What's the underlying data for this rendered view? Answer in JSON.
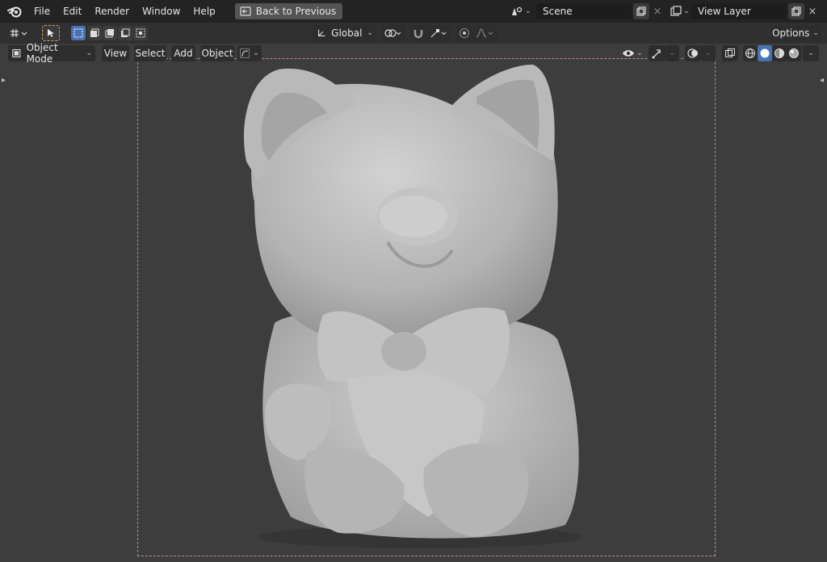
{
  "topbar": {
    "menu": [
      "File",
      "Edit",
      "Render",
      "Window",
      "Help"
    ],
    "back_button": "Back to Previous",
    "scene_value": "Scene",
    "view_layer_value": "View Layer"
  },
  "header": {
    "transform_orientation": "Global",
    "options_label": "Options"
  },
  "viewport_header": {
    "mode": "Object Mode",
    "menus": [
      "View",
      "Select",
      "Add",
      "Object"
    ]
  },
  "icons": {
    "logo": "blender-logo-icon",
    "editor_type": "viewport-editor-icon",
    "select_tool": "cursor-select-icon",
    "pivot": "pivot-icon",
    "snap": "magnet-snap-icon",
    "proportional": "proportional-edit-icon",
    "visibility": "eye-icon",
    "gizmo": "gizmo-icon",
    "overlays": "overlay-icon",
    "xray": "xray-icon",
    "shading_wire": "wireframe-shading-icon",
    "shading_solid": "solid-shading-icon",
    "shading_material": "material-shading-icon",
    "shading_render": "rendered-shading-icon"
  },
  "colors": {
    "topbar_bg": "#232323",
    "viewport_bg": "#3d3d3d",
    "active_blue": "#4772b3",
    "camera_frame": "#c7878a",
    "model_gray": "#bcbcbc"
  }
}
